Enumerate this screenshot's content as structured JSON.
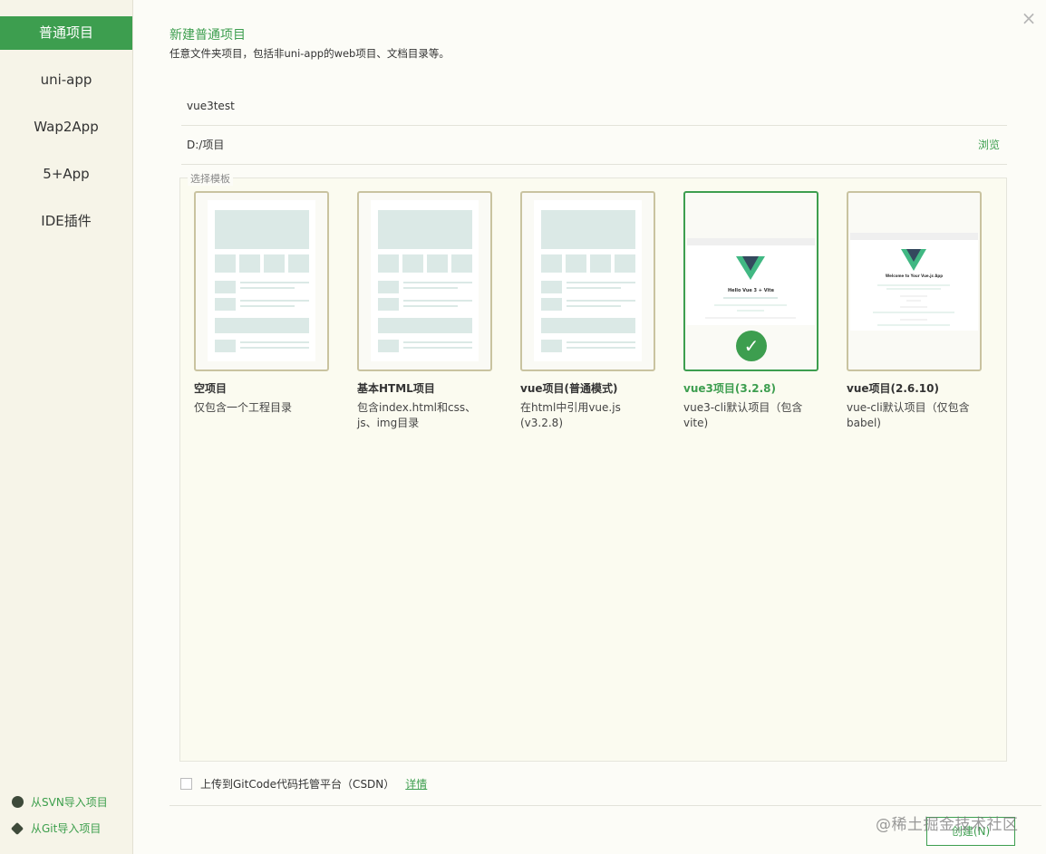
{
  "sidebar": {
    "items": [
      {
        "label": "普通项目",
        "active": true
      },
      {
        "label": "uni-app"
      },
      {
        "label": "Wap2App"
      },
      {
        "label": "5+App"
      },
      {
        "label": "IDE插件"
      }
    ],
    "svn_import": "从SVN导入项目",
    "git_import": "从Git导入项目"
  },
  "header": {
    "title": "新建普通项目",
    "subtitle": "任意文件夹项目，包括非uni-app的web项目、文档目录等。"
  },
  "form": {
    "project_name": "vue3test",
    "location": "D:/项目",
    "browse_label": "浏览"
  },
  "templates": {
    "legend": "选择模板",
    "items": [
      {
        "title": "空项目",
        "desc": "仅包含一个工程目录"
      },
      {
        "title": "基本HTML项目",
        "desc": "包含index.html和css、js、img目录"
      },
      {
        "title": "vue项目(普通模式)",
        "desc": "在html中引用vue.js (v3.2.8)"
      },
      {
        "title": "vue3项目(3.2.8)",
        "desc": "vue3-cli默认项目（包含vite)",
        "selected": true,
        "shot_text": "Hello Vue 3 + Vite"
      },
      {
        "title": "vue项目(2.6.10)",
        "desc": "vue-cli默认项目（仅包含babel)",
        "shot_text": "Welcome to Your Vue.js App"
      }
    ]
  },
  "footer": {
    "upload_label": "上传到GitCode代码托管平台（CSDN）",
    "detail_label": "详情",
    "create_label": "创建(N)",
    "watermark": "@稀土掘金技术社区"
  },
  "colors": {
    "accent": "#3d9e4f",
    "vue_green": "#41b883",
    "vue_dark": "#34495e"
  }
}
